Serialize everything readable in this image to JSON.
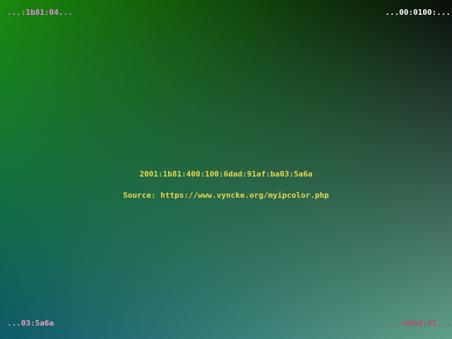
{
  "colors": {
    "background_top_left": "#1a8a0c",
    "background_top_right": "#0a0f0a",
    "background_bottom_left": "#0e5a6a",
    "background_bottom_right": "#60a088",
    "center_text": "#e8d850",
    "top_left_text": "#e888e8",
    "top_right_text": "#ffffff",
    "bottom_left_text": "#f0a0c0",
    "bottom_right_text": "#b84c6c"
  },
  "corners": {
    "top_left": "...:1b81:04...",
    "top_right": "...00:0100:...",
    "bottom_left": "...03:5a6a",
    "bottom_right": "...:6dad:91..."
  },
  "center": {
    "ip_address": "2001:1b81:400:100:6dad:91af:ba03:5a6a",
    "source": "Source: https://www.vyncke.org/myipcolor.php"
  }
}
